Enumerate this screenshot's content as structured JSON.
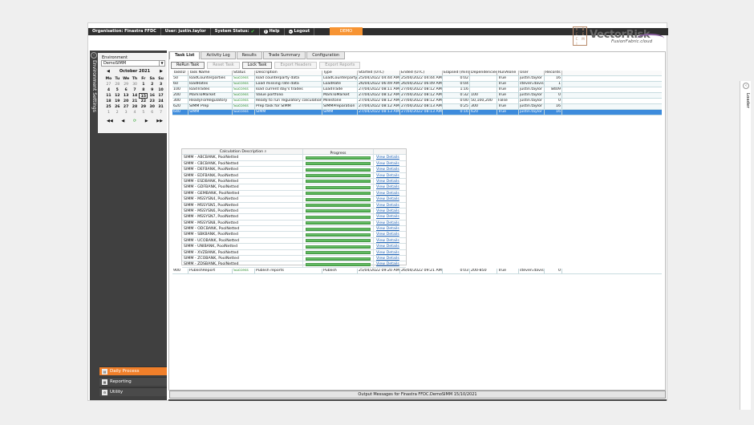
{
  "topbar": {
    "organisation": "Organisation: Finastra FFDC",
    "user": "User: justin.taylor",
    "system_status": "System Status:",
    "help": "Help",
    "logout": "Logout",
    "demo_badge": "DEMO"
  },
  "logo": {
    "grid_letters": [
      "V",
      "B",
      "C",
      "E",
      "C",
      "M",
      "I"
    ],
    "brand": "VectorRisk",
    "sub": "FusionFabric.cloud"
  },
  "sidebar": {
    "title": "Environment Settings",
    "environment_label": "Environment",
    "environment_value": "DemoSIMM",
    "calendar": {
      "month": "October 2021",
      "dow": [
        "Mo",
        "Tu",
        "We",
        "Th",
        "Fr",
        "Sa",
        "Su"
      ],
      "days": [
        [
          "27",
          "28",
          "29",
          "30",
          "1",
          "2",
          "3"
        ],
        [
          "4",
          "5",
          "6",
          "7",
          "8",
          "9",
          "10"
        ],
        [
          "11",
          "12",
          "13",
          "14",
          "15",
          "16",
          "17"
        ],
        [
          "18",
          "19",
          "20",
          "21",
          "22",
          "23",
          "24"
        ],
        [
          "25",
          "26",
          "27",
          "28",
          "29",
          "30",
          "31"
        ],
        [
          "1",
          "2",
          "3",
          "4",
          "5",
          "6",
          "7"
        ]
      ],
      "selected_day": "15"
    },
    "nav": [
      {
        "label": "Daily Process",
        "active": true
      },
      {
        "label": "Reporting",
        "active": false
      },
      {
        "label": "Utility",
        "active": false
      }
    ]
  },
  "tabs": [
    "Task List",
    "Activity Log",
    "Results",
    "Trade Summary",
    "Configuration"
  ],
  "active_tab": "Task List",
  "toolbar": {
    "rerun": "ReRun Task",
    "reset": "Reset Task",
    "lock": "Lock Task",
    "export_headers": "Export Headers",
    "export_reports": "Export Reports"
  },
  "table": {
    "columns": [
      "TaskID",
      "Task Name",
      "Status",
      "Description",
      "Type",
      "Started (UTC)",
      "Ended (UTC)",
      "Elapsed (min)",
      "Dependencies",
      "RunAlone",
      "User",
      "Records"
    ],
    "rows": [
      [
        "50",
        "loadCounterparties",
        "Success",
        "load counterparty data",
        "LoadCounterparty",
        "25/04/2022 04:44 AM",
        "25/04/2022 04:44 AM",
        "0:02",
        "",
        "True",
        "justin.taylor",
        "16"
      ],
      [
        "60",
        "loadRates",
        "Success",
        "Load missing rate data",
        "LoadRate",
        "26/04/2022 06:49 AM",
        "26/04/2022 06:49 AM",
        "0:04",
        "",
        "True",
        "steven.davis",
        "1"
      ],
      [
        "100",
        "loadTrades",
        "Success",
        "load current day's trades",
        "LoadTrade",
        "27/04/2022 08:11 AM",
        "27/04/2022 08:12 AM",
        "1:16",
        "",
        "True",
        "justin.taylor",
        "8409"
      ],
      [
        "200",
        "MarkToMarket",
        "Success",
        "Value portfolio",
        "MarkToMarket",
        "27/04/2022 08:12 AM",
        "27/04/2022 08:12 AM",
        "0:32",
        "100",
        "True",
        "justin.taylor",
        "0"
      ],
      [
        "300",
        "ReadyForRegulatory",
        "Success",
        "Ready to run regulatory calculations",
        "Milestone",
        "27/04/2022 08:12 AM",
        "27/04/2022 08:12 AM",
        "0:00",
        "50,100,200",
        "False",
        "justin.taylor",
        "0"
      ],
      [
        "620",
        "SIMM Prep",
        "Success",
        "Prep task for SIMM",
        "SIMMPreparation",
        "27/04/2022 08:12 AM",
        "27/04/2022 08:13 AM",
        "0:25",
        "300",
        "True",
        "justin.taylor",
        "16"
      ],
      [
        "640",
        "SIMM",
        "Success",
        "SIMM",
        "SIMM",
        "27/04/2022 08:13 AM",
        "27/04/2022 08:13 AM",
        "0:16",
        "620",
        "True",
        "justin.taylor",
        "16"
      ]
    ],
    "selected_row": 6,
    "last_row": [
      "900",
      "PublishReport",
      "Success",
      "Publish reports",
      "Publish",
      "25/04/2022 09:20 AM",
      "26/04/2022 09:21 AM",
      "0:03",
      "200-850",
      "True",
      "steven.davis",
      "0"
    ]
  },
  "calc": {
    "col_desc": "Calculation Description",
    "col_progress": "Progress",
    "link_text": "View Details",
    "progress_pct": 100,
    "items": [
      "SIMM - ABCBANK, PoolNetted",
      "SIMM - CBCBANK, PoolNetted",
      "SIMM - DEFBANK, PoolNetted",
      "SIMM - EDFBANK, PoolNetted",
      "SIMM - ESDBANK, PoolNetted",
      "SIMM - GDFBANK, PoolNetted",
      "SIMM - GEMBANK, PoolNetted",
      "SIMM - MSSYSN4, PoolNetted",
      "SIMM - MSSYSN5, PoolNetted",
      "SIMM - MSSYSN6, PoolNetted",
      "SIMM - MSSYSN7, PoolNetted",
      "SIMM - MSSYSN8, PoolNetted",
      "SIMM - ODCBANK, PoolNetted",
      "SIMM - SBKBANK, PoolNetted",
      "SIMM - UCOBANK, PoolNetted",
      "SIMM - UNIBANK, PoolNetted",
      "SIMM - XVZBANK, PoolNetted",
      "SIMM - ZCOBANK, PoolNetted",
      "SIMM - ZDSBANK, PoolNetted"
    ]
  },
  "loader_label": "Loader",
  "output_bar": "Output Messages for Finastra FFDC.DemoSIMM 15/10/2021",
  "colors": {
    "accent": "#f07f2a",
    "selected_row": "#3d8bdc",
    "success": "#2a8a2a",
    "progress": "#3ea03e",
    "link": "#1a5fb4"
  }
}
